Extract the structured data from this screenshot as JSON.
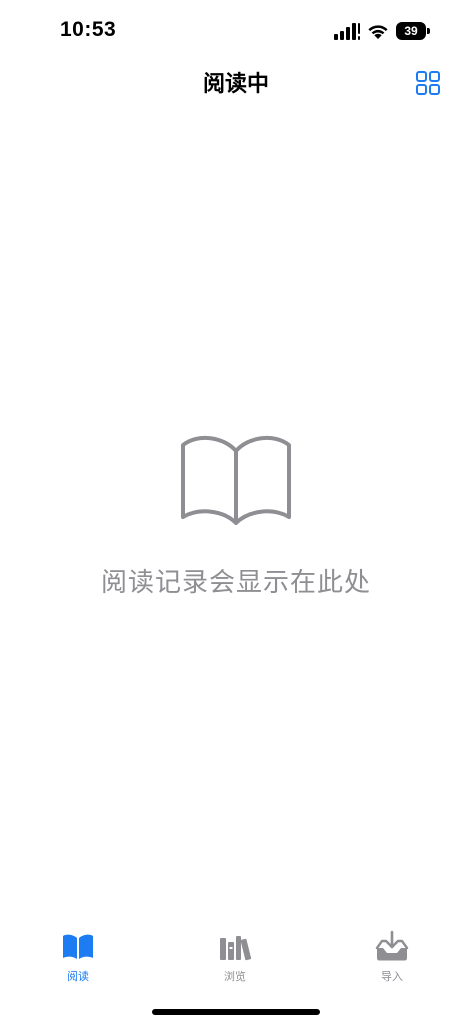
{
  "status_bar": {
    "time": "10:53",
    "battery": "39"
  },
  "header": {
    "title": "阅读中",
    "grid_icon": "grid-view-icon"
  },
  "empty_state": {
    "icon": "open-book-icon",
    "message": "阅读记录会显示在此处"
  },
  "tab_bar": {
    "tabs": [
      {
        "label": "阅读",
        "icon": "book-fill-icon",
        "active": true
      },
      {
        "label": "浏览",
        "icon": "books-shelf-icon",
        "active": false
      },
      {
        "label": "导入",
        "icon": "tray-download-icon",
        "active": false
      }
    ]
  },
  "colors": {
    "accent": "#1e7cf2",
    "secondary_text": "#8e8e93",
    "icon_gray": "#8e8e93"
  }
}
